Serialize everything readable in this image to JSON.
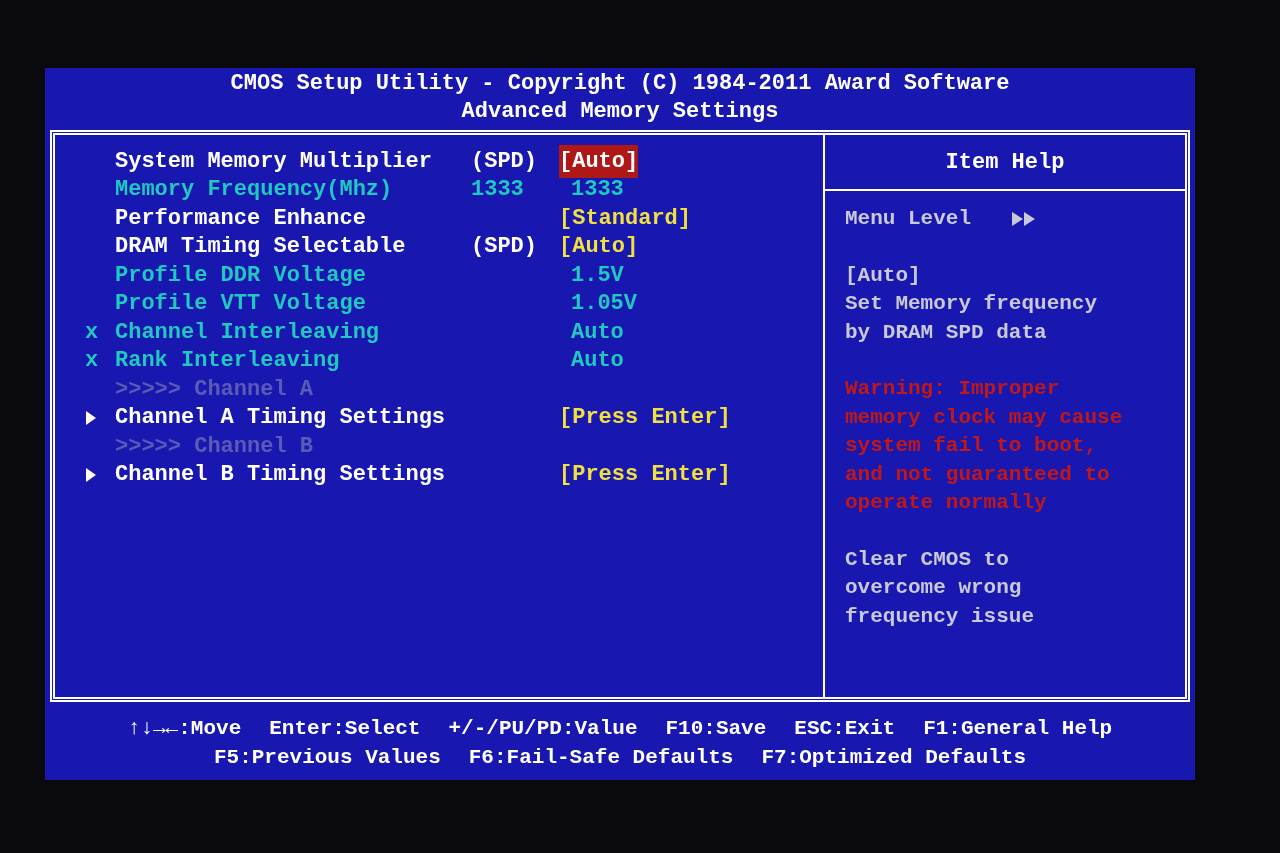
{
  "header": {
    "title": "CMOS Setup Utility - Copyright (C) 1984-2011 Award Software",
    "subtitle": "Advanced Memory Settings"
  },
  "items": [
    {
      "kind": "setting",
      "label": "System Memory Multiplier",
      "middle": "(SPD)",
      "value": "[Auto]",
      "selected": true
    },
    {
      "kind": "info",
      "label": "Memory Frequency(Mhz)",
      "middle": "1333",
      "value": "1333",
      "selected": false
    },
    {
      "kind": "setting",
      "label": "Performance Enhance",
      "value": "[Standard]",
      "selected": false
    },
    {
      "kind": "setting",
      "label": "DRAM Timing Selectable",
      "middle": "(SPD)",
      "value": "[Auto]",
      "selected": false
    },
    {
      "kind": "info",
      "label": "Profile DDR Voltage",
      "value": "1.5V",
      "selected": false
    },
    {
      "kind": "info",
      "label": "Profile VTT Voltage",
      "value": "1.05V",
      "selected": false
    },
    {
      "kind": "info",
      "marker": "x",
      "label": "Channel Interleaving",
      "value": "Auto",
      "selected": false
    },
    {
      "kind": "info",
      "marker": "x",
      "label": "Rank Interleaving",
      "value": "Auto",
      "selected": false
    },
    {
      "kind": "header",
      "label": ">>>>> Channel A"
    },
    {
      "kind": "submenu",
      "label": "Channel A Timing Settings",
      "value": "[Press Enter]",
      "selected": false
    },
    {
      "kind": "header",
      "label": ">>>>> Channel B"
    },
    {
      "kind": "submenu",
      "label": "Channel B Timing Settings",
      "value": "[Press Enter]",
      "selected": false
    }
  ],
  "help": {
    "title": "Item Help",
    "menu_level": "Menu Level",
    "paragraphs": [
      {
        "kind": "normal",
        "lines": [
          "[Auto]",
          "Set Memory frequency",
          "by DRAM SPD data"
        ]
      },
      {
        "kind": "warning",
        "lines": [
          "Warning: Improper",
          "memory clock may cause",
          "system fail to boot,",
          "and not guaranteed to",
          "operate normally"
        ]
      },
      {
        "kind": "normal",
        "lines": [
          "Clear CMOS to",
          "overcome wrong",
          "frequency issue"
        ]
      }
    ]
  },
  "footer": [
    [
      "↑↓→←:Move",
      "Enter:Select",
      "+/-/PU/PD:Value",
      "F10:Save",
      "ESC:Exit",
      "F1:General Help"
    ],
    [
      "F5:Previous Values",
      "F6:Fail-Safe Defaults",
      "F7:Optimized Defaults"
    ]
  ]
}
